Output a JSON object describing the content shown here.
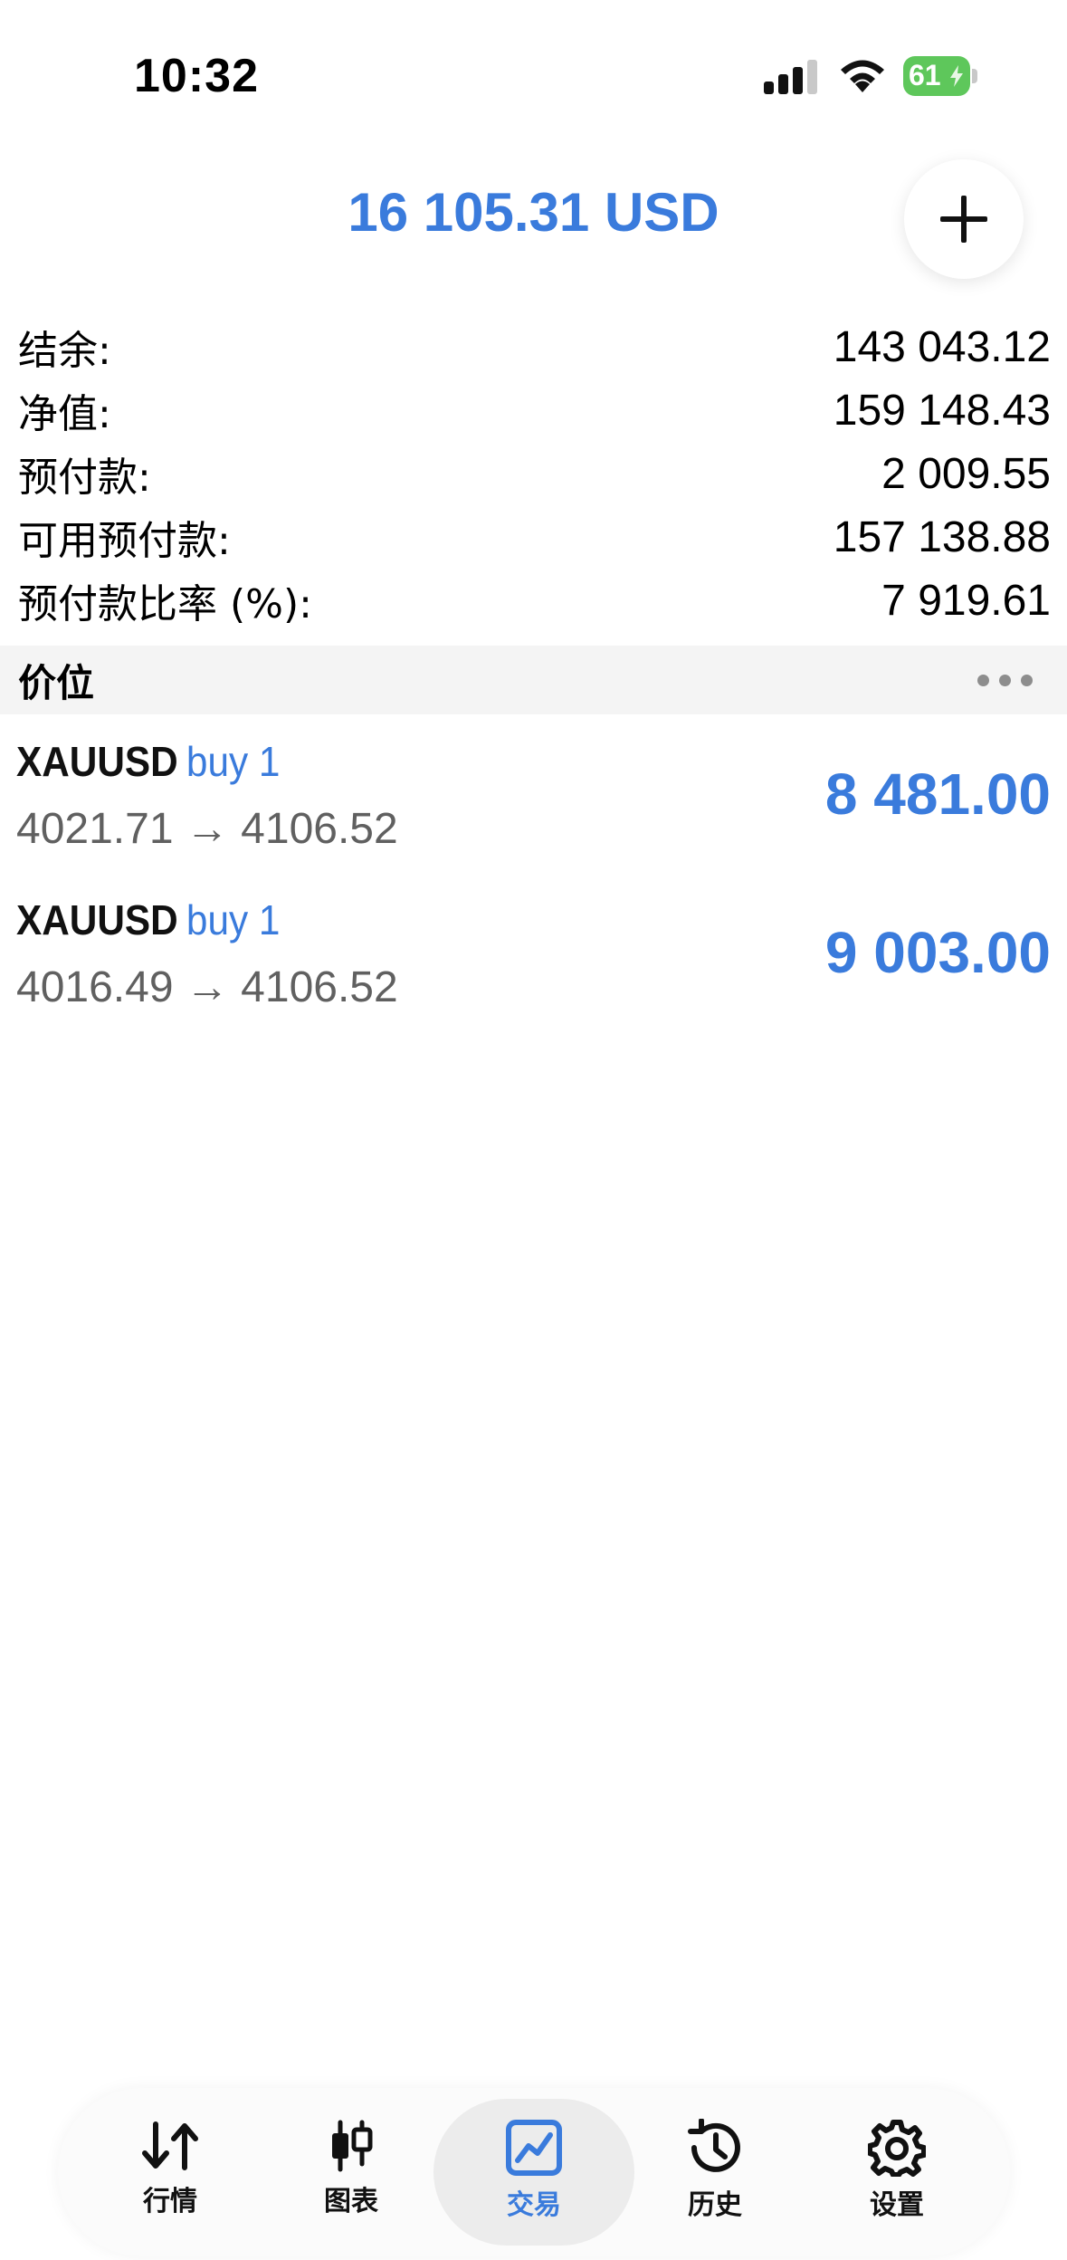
{
  "status_bar": {
    "time": "10:32",
    "battery_level": "61",
    "icons": [
      "signal-icon",
      "wifi-icon",
      "battery-icon"
    ]
  },
  "header": {
    "title": "16 105.31 USD",
    "add_icon": "plus-icon"
  },
  "summary": [
    {
      "label": "结余:",
      "value": "143 043.12"
    },
    {
      "label": "净值:",
      "value": "159 148.43"
    },
    {
      "label": "预付款:",
      "value": "2 009.55"
    },
    {
      "label": "可用预付款:",
      "value": "157 138.88"
    },
    {
      "label": "预付款比率 (%):",
      "value": "7 919.61"
    }
  ],
  "positions_section": {
    "title": "价位",
    "more_icon": "more-icon"
  },
  "positions": [
    {
      "symbol": "XAUUSD",
      "side": "buy 1",
      "prices": "4021.71 → 4106.52",
      "profit": "8 481.00"
    },
    {
      "symbol": "XAUUSD",
      "side": "buy 1",
      "prices": "4016.49 → 4106.52",
      "profit": "9 003.00"
    }
  ],
  "tabs": [
    {
      "label": "行情",
      "icon": "quotes-icon"
    },
    {
      "label": "图表",
      "icon": "chart-icon"
    },
    {
      "label": "交易",
      "icon": "trade-icon",
      "active": true
    },
    {
      "label": "历史",
      "icon": "history-icon"
    },
    {
      "label": "设置",
      "icon": "settings-icon"
    }
  ],
  "colors": {
    "accent": "#3a7bdc",
    "battery": "#5ec75b",
    "secondary_text": "#606060"
  }
}
